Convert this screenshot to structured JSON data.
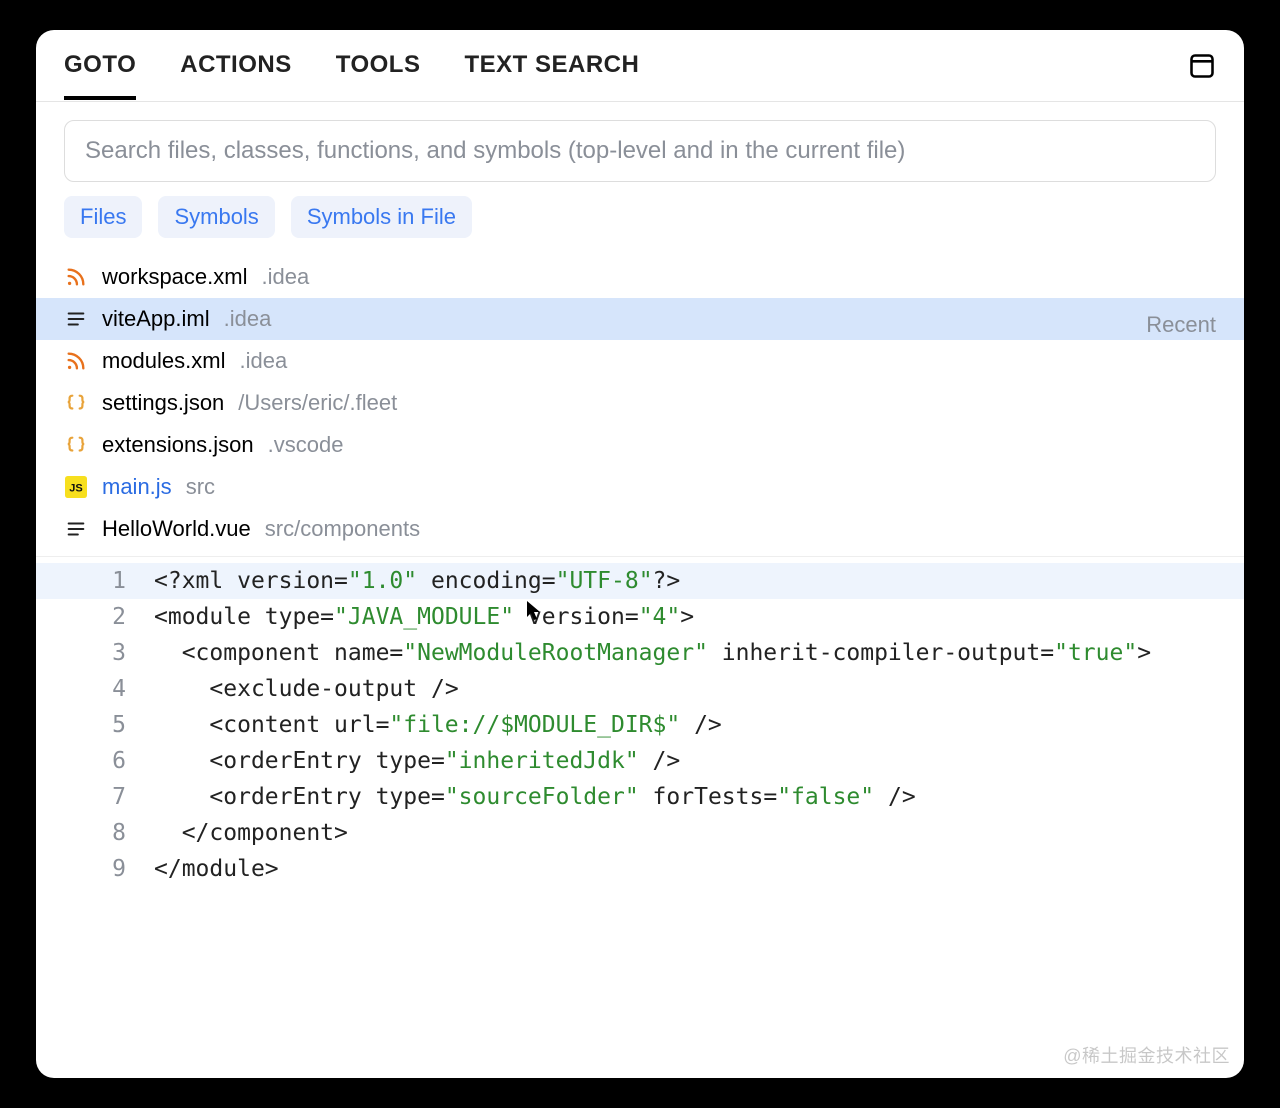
{
  "tabs": {
    "goto": "GOTO",
    "actions": "ACTIONS",
    "tools": "TOOLS",
    "text_search": "TEXT SEARCH"
  },
  "search": {
    "placeholder": "Search files, classes, functions, and symbols (top-level and in the current file)",
    "value": ""
  },
  "chips": {
    "files": "Files",
    "symbols": "Symbols",
    "symbols_in_file": "Symbols in File"
  },
  "recent_label": "Recent",
  "files": [
    {
      "icon": "rss",
      "name": "workspace.xml",
      "path": ".idea",
      "selected": false,
      "link": false
    },
    {
      "icon": "lines",
      "name": "viteApp.iml",
      "path": ".idea",
      "selected": true,
      "link": false
    },
    {
      "icon": "rss",
      "name": "modules.xml",
      "path": ".idea",
      "selected": false,
      "link": false
    },
    {
      "icon": "braces",
      "name": "settings.json",
      "path": "/Users/eric/.fleet",
      "selected": false,
      "link": false
    },
    {
      "icon": "braces",
      "name": "extensions.json",
      "path": ".vscode",
      "selected": false,
      "link": false
    },
    {
      "icon": "js",
      "name": "main.js",
      "path": "src",
      "selected": false,
      "link": true
    },
    {
      "icon": "lines",
      "name": "HelloWorld.vue",
      "path": "src/components",
      "selected": false,
      "link": false
    }
  ],
  "code": {
    "lines": [
      {
        "n": "1",
        "hl": true,
        "tokens": [
          {
            "t": "<?",
            "c": "punct"
          },
          {
            "t": "xml ",
            "c": "tagn"
          },
          {
            "t": "version=",
            "c": "attr"
          },
          {
            "t": "\"1.0\"",
            "c": "str"
          },
          {
            "t": " encoding=",
            "c": "attr"
          },
          {
            "t": "\"UTF-8\"",
            "c": "str"
          },
          {
            "t": "?>",
            "c": "punct"
          }
        ]
      },
      {
        "n": "2",
        "hl": false,
        "tokens": [
          {
            "t": "<",
            "c": "punct"
          },
          {
            "t": "module ",
            "c": "tagn"
          },
          {
            "t": "type=",
            "c": "attr"
          },
          {
            "t": "\"JAVA_MODULE\"",
            "c": "str"
          },
          {
            "t": " version=",
            "c": "attr"
          },
          {
            "t": "\"4\"",
            "c": "str"
          },
          {
            "t": ">",
            "c": "punct"
          }
        ]
      },
      {
        "n": "3",
        "hl": false,
        "tokens": [
          {
            "t": "  <",
            "c": "punct"
          },
          {
            "t": "component ",
            "c": "tagn"
          },
          {
            "t": "name=",
            "c": "attr"
          },
          {
            "t": "\"NewModuleRootManager\"",
            "c": "str"
          },
          {
            "t": " inherit-compiler-output=",
            "c": "attr"
          },
          {
            "t": "\"true\"",
            "c": "str"
          },
          {
            "t": ">",
            "c": "punct"
          }
        ]
      },
      {
        "n": "4",
        "hl": false,
        "tokens": [
          {
            "t": "    <",
            "c": "punct"
          },
          {
            "t": "exclude-output ",
            "c": "tagn"
          },
          {
            "t": "/>",
            "c": "punct"
          }
        ]
      },
      {
        "n": "5",
        "hl": false,
        "tokens": [
          {
            "t": "    <",
            "c": "punct"
          },
          {
            "t": "content ",
            "c": "tagn"
          },
          {
            "t": "url=",
            "c": "attr"
          },
          {
            "t": "\"file://$MODULE_DIR$\"",
            "c": "str"
          },
          {
            "t": " />",
            "c": "punct"
          }
        ]
      },
      {
        "n": "6",
        "hl": false,
        "tokens": [
          {
            "t": "    <",
            "c": "punct"
          },
          {
            "t": "orderEntry ",
            "c": "tagn"
          },
          {
            "t": "type=",
            "c": "attr"
          },
          {
            "t": "\"inheritedJdk\"",
            "c": "str"
          },
          {
            "t": " />",
            "c": "punct"
          }
        ]
      },
      {
        "n": "7",
        "hl": false,
        "tokens": [
          {
            "t": "    <",
            "c": "punct"
          },
          {
            "t": "orderEntry ",
            "c": "tagn"
          },
          {
            "t": "type=",
            "c": "attr"
          },
          {
            "t": "\"sourceFolder\"",
            "c": "str"
          },
          {
            "t": " forTests=",
            "c": "attr"
          },
          {
            "t": "\"false\"",
            "c": "str"
          },
          {
            "t": " />",
            "c": "punct"
          }
        ]
      },
      {
        "n": "8",
        "hl": false,
        "tokens": [
          {
            "t": "  </",
            "c": "punct"
          },
          {
            "t": "component",
            "c": "tagn"
          },
          {
            "t": ">",
            "c": "punct"
          }
        ]
      },
      {
        "n": "9",
        "hl": false,
        "tokens": [
          {
            "t": "</",
            "c": "punct"
          },
          {
            "t": "module",
            "c": "tagn"
          },
          {
            "t": ">",
            "c": "punct"
          }
        ]
      }
    ]
  },
  "watermark": "@稀土掘金技术社区"
}
